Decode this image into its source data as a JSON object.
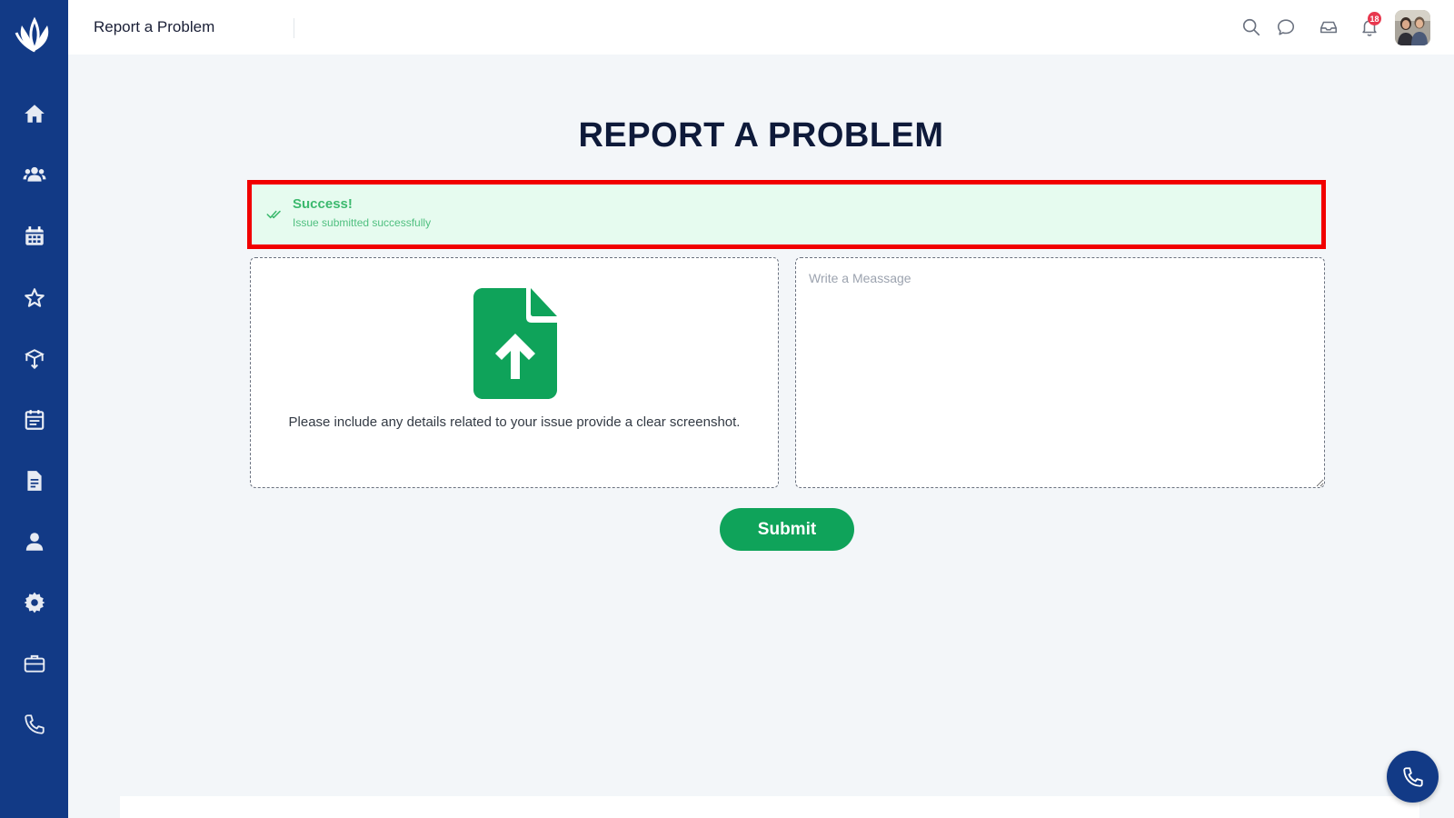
{
  "header": {
    "title": "Report a Problem",
    "notification_count": "18",
    "icons": [
      "search-icon",
      "chat-icon",
      "inbox-icon",
      "bell-icon"
    ]
  },
  "sidebar": {
    "items": [
      {
        "name": "home",
        "icon": "home-icon"
      },
      {
        "name": "users",
        "icon": "users-icon"
      },
      {
        "name": "calendar",
        "icon": "calendar-icon"
      },
      {
        "name": "favorites",
        "icon": "star-icon"
      },
      {
        "name": "inventory",
        "icon": "box-icon"
      },
      {
        "name": "schedule",
        "icon": "schedule-icon"
      },
      {
        "name": "documents",
        "icon": "document-icon"
      },
      {
        "name": "profile",
        "icon": "user-icon"
      },
      {
        "name": "settings",
        "icon": "gear-icon"
      },
      {
        "name": "jobs",
        "icon": "briefcase-icon"
      },
      {
        "name": "calls",
        "icon": "phone-icon"
      }
    ]
  },
  "main": {
    "heading": "REPORT A PROBLEM",
    "alert": {
      "title": "Success!",
      "message": "Issue submitted successfully"
    },
    "upload": {
      "instructions": "Please include any details related to your issue provide a clear screenshot."
    },
    "message": {
      "placeholder": "Write a Meassage",
      "value": ""
    },
    "submit_label": "Submit"
  },
  "colors": {
    "sidebar": "#123a86",
    "accent_green": "#0fa35a",
    "alert_border": "#f10000",
    "alert_bg": "#e6fbef",
    "badge": "#e8384f"
  }
}
